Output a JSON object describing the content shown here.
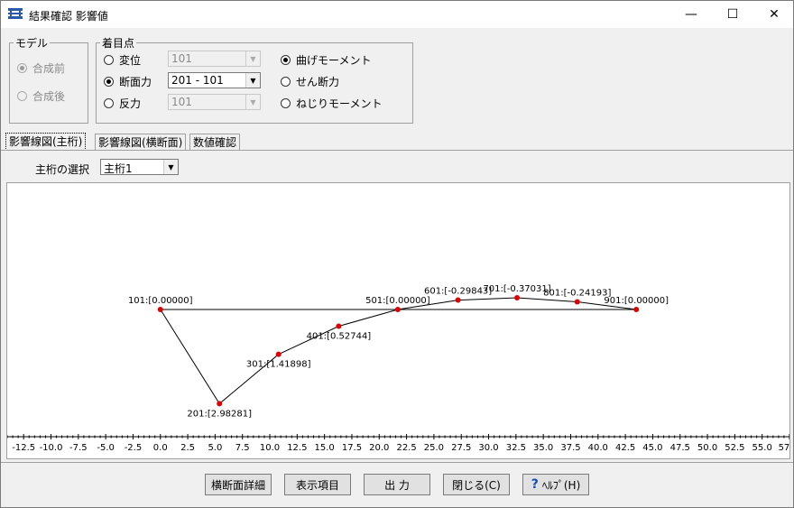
{
  "window": {
    "title": "結果確認 影響値",
    "minimize": "—",
    "maximize": "☐",
    "close": "✕"
  },
  "model_group": {
    "legend": "モデル",
    "options": [
      {
        "label": "合成前",
        "checked": true
      },
      {
        "label": "合成後",
        "checked": false
      }
    ]
  },
  "focus_group": {
    "legend": "着目点",
    "rows": [
      {
        "label": "変位",
        "checked": false,
        "combo": "101",
        "enabled": false
      },
      {
        "label": "断面力",
        "checked": true,
        "combo": "201 - 101",
        "enabled": true
      },
      {
        "label": "反力",
        "checked": false,
        "combo": "101",
        "enabled": false
      }
    ],
    "force_options": [
      {
        "label": "曲げモーメント",
        "checked": true
      },
      {
        "label": "せん断力",
        "checked": false
      },
      {
        "label": "ねじりモーメント",
        "checked": false
      }
    ]
  },
  "tabs": [
    {
      "label": "影響線図(主桁)",
      "active": true
    },
    {
      "label": "影響線図(横断面)",
      "active": false
    },
    {
      "label": "数値確認",
      "active": false
    }
  ],
  "girder_select": {
    "label": "主桁の選択",
    "value": "主桁1"
  },
  "chart_data": {
    "type": "line",
    "x_ticks": [
      "-12.5",
      "-10.0",
      "-7.5",
      "-5.0",
      "-2.5",
      "0.0",
      "2.5",
      "5.0",
      "7.5",
      "10.0",
      "12.5",
      "15.0",
      "17.5",
      "20.0",
      "22.5",
      "25.0",
      "27.5",
      "30.0",
      "32.5",
      "35.0",
      "37.5",
      "40.0",
      "42.5",
      "45.0",
      "47.5",
      "50.0",
      "52.5",
      "55.0",
      "57"
    ],
    "xlim": [
      -14.0,
      57.5
    ],
    "ylim": [
      -0.6,
      3.4
    ],
    "points": [
      {
        "x": 0.0,
        "y": 0.0,
        "label": "101:[0.00000]"
      },
      {
        "x": 5.4,
        "y": 2.98281,
        "label": "201:[2.98281]"
      },
      {
        "x": 10.8,
        "y": 1.41898,
        "label": "301:[1.41898]"
      },
      {
        "x": 16.3,
        "y": 0.52744,
        "label": "401:[0.52744]"
      },
      {
        "x": 21.7,
        "y": 0.0,
        "label": "501:[0.00000]"
      },
      {
        "x": 27.2,
        "y": -0.29843,
        "label": "601:[-0.29843]"
      },
      {
        "x": 32.6,
        "y": -0.37031,
        "label": "701:[-0.37031]"
      },
      {
        "x": 38.1,
        "y": -0.24193,
        "label": "801:[-0.24193]"
      },
      {
        "x": 43.5,
        "y": 0.0,
        "label": "901:[0.00000]"
      }
    ],
    "line_color": "#000000",
    "point_color": "#e00000"
  },
  "buttons": {
    "cross_section_detail": "横断面詳細",
    "display_items": "表示項目",
    "output": "出 力",
    "close": "閉じる(C)",
    "help": "ﾍﾙﾌﾟ(H)"
  }
}
